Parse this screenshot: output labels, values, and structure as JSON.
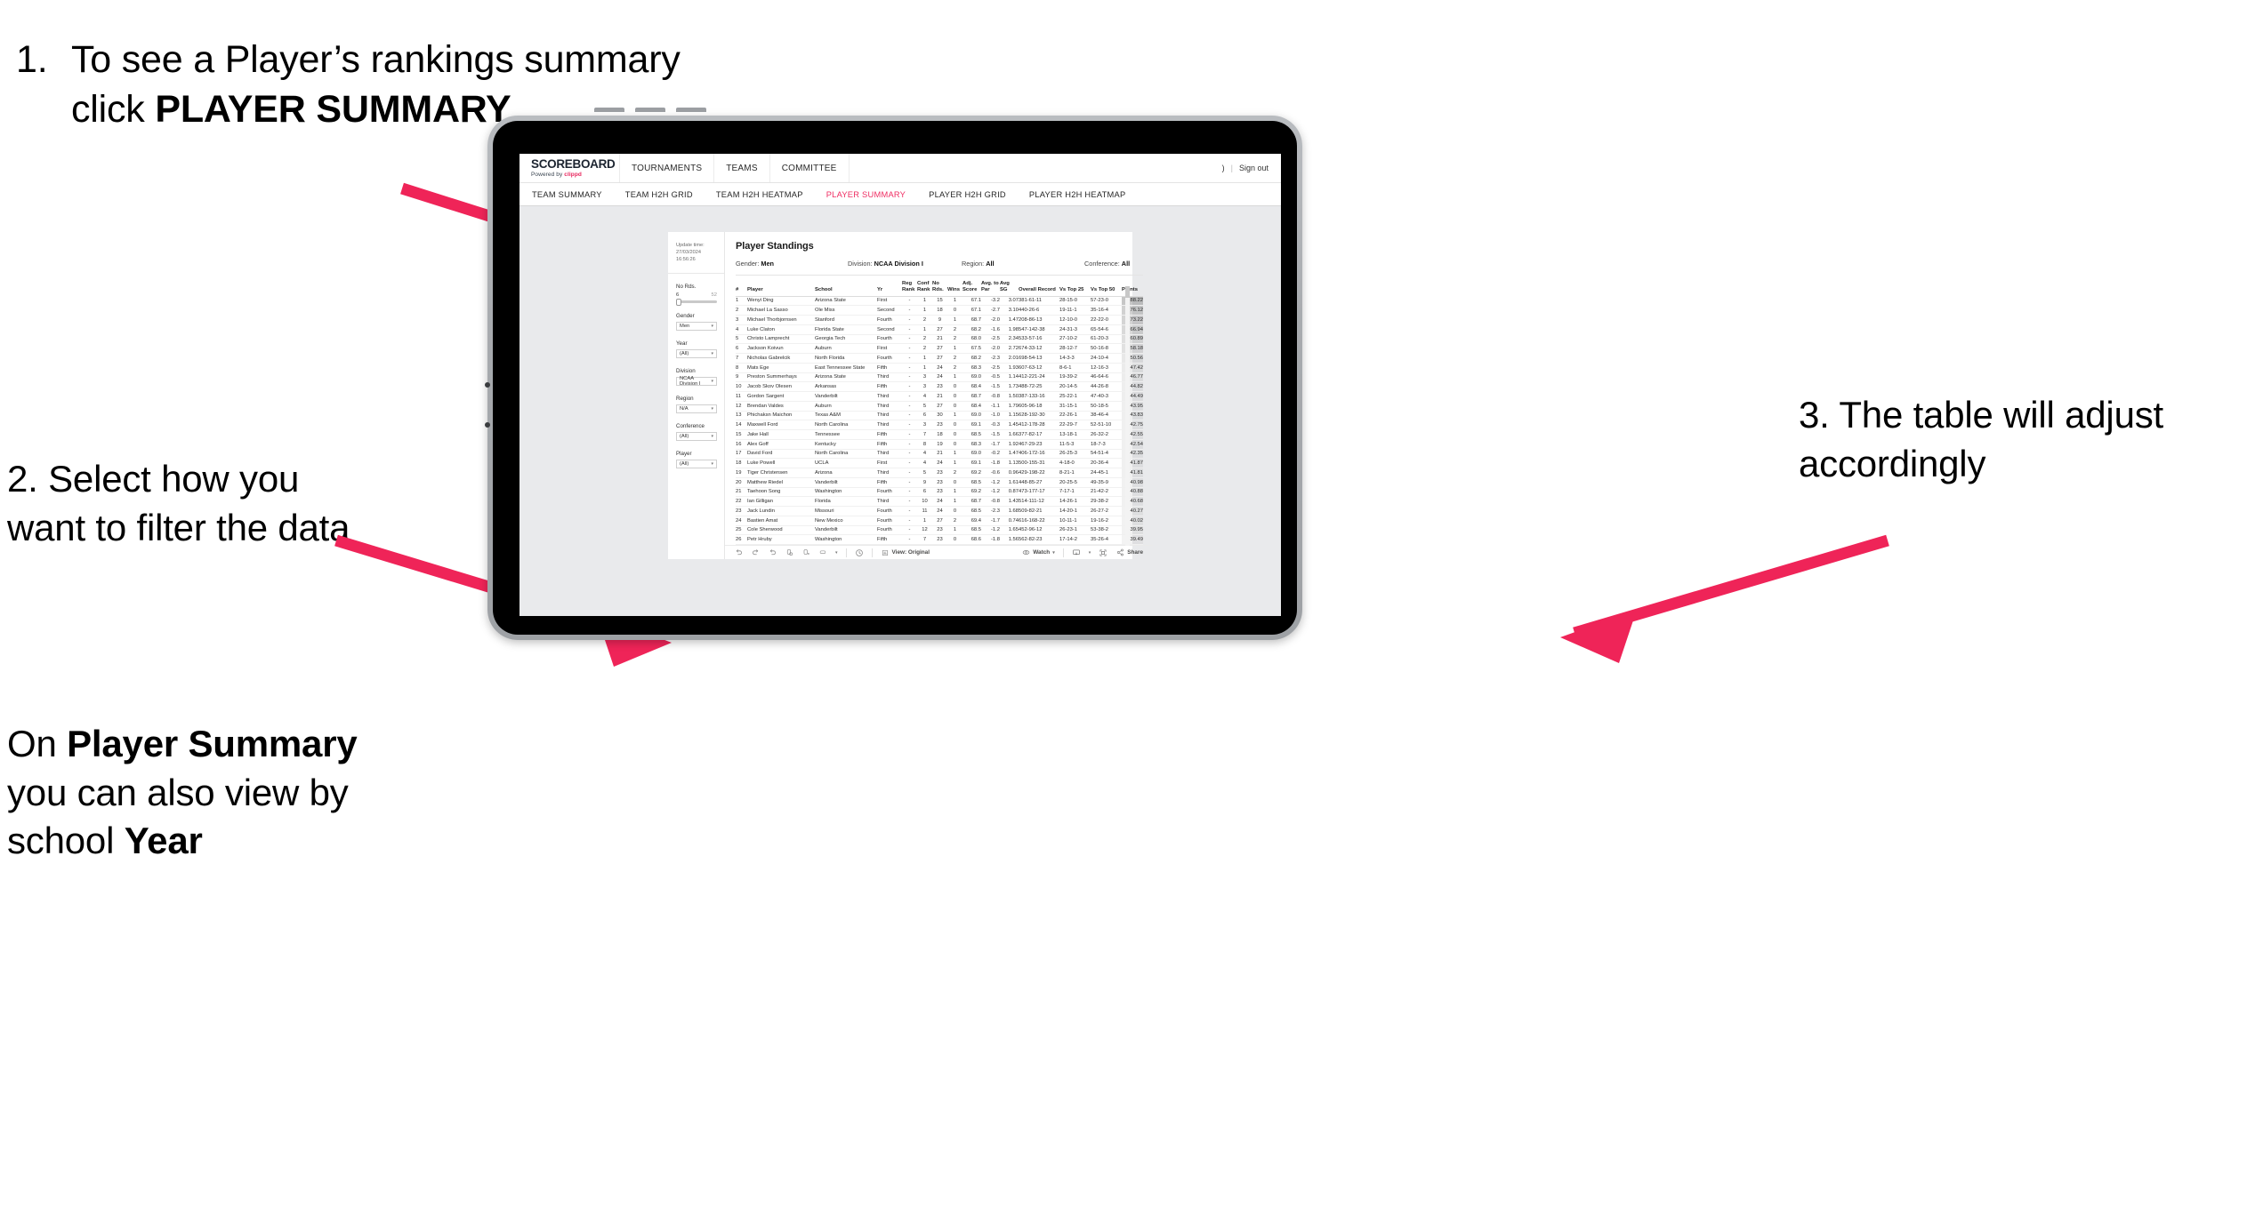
{
  "annotations": {
    "step1": {
      "number": "1.",
      "text_before": "To see a Player’s rankings summary click ",
      "bold": "PLAYER SUMMARY"
    },
    "step2": {
      "text": "2. Select how you want to filter the data"
    },
    "step2b": {
      "line1_before": "On ",
      "line1_bold": "Player Summary",
      "line1_after": " you can also view by school ",
      "line1_bold2": "Year"
    },
    "step3": {
      "text": "3. The table will adjust accordingly"
    },
    "arrow_color": "#ef2458"
  },
  "app": {
    "brand_name": "SCOREBOARD",
    "brand_sub_prefix": "Powered by ",
    "brand_sub_link": "clippd",
    "top_nav": [
      "TOURNAMENTS",
      "TEAMS",
      "COMMITTEE"
    ],
    "user_initial": ")",
    "separator": "|",
    "sign_out": "Sign out",
    "sub_nav": [
      {
        "label": "TEAM SUMMARY",
        "active": false
      },
      {
        "label": "TEAM H2H GRID",
        "active": false
      },
      {
        "label": "TEAM H2H HEATMAP",
        "active": false
      },
      {
        "label": "PLAYER SUMMARY",
        "active": true
      },
      {
        "label": "PLAYER H2H GRID",
        "active": false
      },
      {
        "label": "PLAYER H2H HEATMAP",
        "active": false
      }
    ],
    "active_tab_color": "#ef2d62"
  },
  "sidebar": {
    "update_label": "Update time:",
    "update_value": "27/03/2024 16:56:26",
    "slider": {
      "title": "No Rds.",
      "min": "6",
      "max": "52"
    },
    "filters": [
      {
        "title": "Gender",
        "value": "Men"
      },
      {
        "title": "Year",
        "value": "(All)"
      },
      {
        "title": "Division",
        "value": "NCAA Division I"
      },
      {
        "title": "Region",
        "value": "N/A"
      },
      {
        "title": "Conference",
        "value": "(All)"
      },
      {
        "title": "Player",
        "value": "(All)"
      }
    ]
  },
  "sheet": {
    "title": "Player Standings",
    "summary": [
      {
        "label": "Gender:",
        "value": "Men"
      },
      {
        "label": "Division:",
        "value": "NCAA Division I"
      },
      {
        "label": "Region:",
        "value": "All"
      },
      {
        "label": "Conference:",
        "value": "All"
      }
    ],
    "toolbar": {
      "view_label": "View: Original",
      "watch_label": "Watch",
      "share_label": "Share"
    }
  },
  "chart_data": {
    "type": "table",
    "title": "Player Standings",
    "columns": [
      {
        "key": "rank",
        "label": "#"
      },
      {
        "key": "player",
        "label": "Player"
      },
      {
        "key": "school",
        "label": "School"
      },
      {
        "key": "yr",
        "label": "Yr"
      },
      {
        "key": "reg_rank",
        "label": "Reg Rank"
      },
      {
        "key": "conf_rank",
        "label": "Conf Rank"
      },
      {
        "key": "no_rds",
        "label": "No Rds."
      },
      {
        "key": "wins",
        "label": "Wins"
      },
      {
        "key": "adj_score",
        "label": "Adj. Score"
      },
      {
        "key": "avg_to_par",
        "label": "Avg. to Par"
      },
      {
        "key": "avg_sg",
        "label": "Avg SG"
      },
      {
        "key": "overall_record",
        "label": "Overall Record"
      },
      {
        "key": "vs_top_25",
        "label": "Vs Top 25"
      },
      {
        "key": "vs_top_50",
        "label": "Vs Top 50"
      },
      {
        "key": "points",
        "label": "Points"
      }
    ],
    "rows": [
      [
        "1",
        "Wenyi Ding",
        "Arizona State",
        "First",
        "-",
        "1",
        "15",
        "1",
        "67.1",
        "-3.2",
        "3.07",
        "381-61-11",
        "28-15-0",
        "57-23-0",
        "88.22"
      ],
      [
        "2",
        "Michael La Sasso",
        "Ole Miss",
        "Second",
        "-",
        "1",
        "18",
        "0",
        "67.1",
        "-2.7",
        "3.10",
        "440-26-6",
        "19-11-1",
        "35-16-4",
        "76.12"
      ],
      [
        "3",
        "Michael Thorbjornsen",
        "Stanford",
        "Fourth",
        "-",
        "2",
        "9",
        "1",
        "68.7",
        "-2.0",
        "1.47",
        "208-86-13",
        "12-10-0",
        "22-22-0",
        "73.22"
      ],
      [
        "4",
        "Luke Claton",
        "Florida State",
        "Second",
        "-",
        "1",
        "27",
        "2",
        "68.2",
        "-1.6",
        "1.98",
        "547-142-38",
        "24-31-3",
        "65-54-6",
        "66.94"
      ],
      [
        "5",
        "Christo Lamprecht",
        "Georgia Tech",
        "Fourth",
        "-",
        "2",
        "21",
        "2",
        "68.0",
        "-2.5",
        "2.34",
        "533-57-16",
        "27-10-2",
        "61-20-3",
        "60.89"
      ],
      [
        "6",
        "Jackson Koivun",
        "Auburn",
        "First",
        "-",
        "2",
        "27",
        "1",
        "67.5",
        "-2.0",
        "2.72",
        "674-33-12",
        "28-12-7",
        "50-16-8",
        "58.18"
      ],
      [
        "7",
        "Nicholas Gabrelcik",
        "North Florida",
        "Fourth",
        "-",
        "1",
        "27",
        "2",
        "68.2",
        "-2.3",
        "2.01",
        "698-54-13",
        "14-3-3",
        "24-10-4",
        "50.56"
      ],
      [
        "8",
        "Mats Ege",
        "East Tennessee State",
        "Fifth",
        "-",
        "1",
        "24",
        "2",
        "68.3",
        "-2.5",
        "1.93",
        "607-63-12",
        "8-6-1",
        "12-16-3",
        "47.42"
      ],
      [
        "9",
        "Preston Summerhays",
        "Arizona State",
        "Third",
        "-",
        "3",
        "24",
        "1",
        "69.0",
        "-0.5",
        "1.14",
        "412-221-24",
        "19-39-2",
        "46-64-6",
        "46.77"
      ],
      [
        "10",
        "Jacob Skov Olesen",
        "Arkansas",
        "Fifth",
        "-",
        "3",
        "23",
        "0",
        "68.4",
        "-1.5",
        "1.73",
        "488-72-25",
        "20-14-5",
        "44-26-8",
        "44.82"
      ],
      [
        "11",
        "Gordon Sargent",
        "Vanderbilt",
        "Third",
        "-",
        "4",
        "21",
        "0",
        "68.7",
        "-0.8",
        "1.50",
        "387-133-16",
        "25-22-1",
        "47-40-3",
        "44.49"
      ],
      [
        "12",
        "Brendan Valdes",
        "Auburn",
        "Third",
        "-",
        "5",
        "27",
        "0",
        "68.4",
        "-1.1",
        "1.79",
        "605-96-18",
        "31-15-1",
        "50-18-5",
        "43.95"
      ],
      [
        "13",
        "Phichaksn Maichon",
        "Texas A&M",
        "Third",
        "-",
        "6",
        "30",
        "1",
        "69.0",
        "-1.0",
        "1.15",
        "628-192-30",
        "22-26-1",
        "38-46-4",
        "43.83"
      ],
      [
        "14",
        "Maxwell Ford",
        "North Carolina",
        "Third",
        "-",
        "3",
        "23",
        "0",
        "69.1",
        "-0.3",
        "1.45",
        "412-178-28",
        "22-29-7",
        "52-51-10",
        "42.75"
      ],
      [
        "15",
        "Jake Hall",
        "Tennessee",
        "Fifth",
        "-",
        "7",
        "18",
        "0",
        "68.5",
        "-1.5",
        "1.66",
        "377-82-17",
        "13-18-1",
        "26-32-2",
        "42.55"
      ],
      [
        "16",
        "Alex Goff",
        "Kentucky",
        "Fifth",
        "-",
        "8",
        "19",
        "0",
        "68.3",
        "-1.7",
        "1.92",
        "467-29-23",
        "11-5-3",
        "18-7-3",
        "42.54"
      ],
      [
        "17",
        "David Ford",
        "North Carolina",
        "Third",
        "-",
        "4",
        "21",
        "1",
        "69.0",
        "-0.2",
        "1.47",
        "406-172-16",
        "26-25-3",
        "54-51-4",
        "42.35"
      ],
      [
        "18",
        "Luke Powell",
        "UCLA",
        "First",
        "-",
        "4",
        "24",
        "1",
        "69.1",
        "-1.8",
        "1.13",
        "500-155-31",
        "4-18-0",
        "20-36-4",
        "41.87"
      ],
      [
        "19",
        "Tiger Christensen",
        "Arizona",
        "Third",
        "-",
        "5",
        "23",
        "2",
        "69.2",
        "-0.6",
        "0.96",
        "429-198-22",
        "8-21-1",
        "24-45-1",
        "41.81"
      ],
      [
        "20",
        "Matthew Riedel",
        "Vanderbilt",
        "Fifth",
        "-",
        "9",
        "23",
        "0",
        "68.5",
        "-1.2",
        "1.61",
        "448-85-27",
        "20-25-5",
        "49-35-9",
        "40.98"
      ],
      [
        "21",
        "Taehoon Song",
        "Washington",
        "Fourth",
        "-",
        "6",
        "23",
        "1",
        "69.2",
        "-1.2",
        "0.87",
        "473-177-17",
        "7-17-1",
        "21-42-2",
        "40.88"
      ],
      [
        "22",
        "Ian Gilligan",
        "Florida",
        "Third",
        "-",
        "10",
        "24",
        "1",
        "68.7",
        "-0.8",
        "1.43",
        "514-111-12",
        "14-26-1",
        "29-38-2",
        "40.68"
      ],
      [
        "23",
        "Jack Lundin",
        "Missouri",
        "Fourth",
        "-",
        "11",
        "24",
        "0",
        "68.5",
        "-2.3",
        "1.68",
        "509-82-21",
        "14-20-1",
        "26-27-2",
        "40.27"
      ],
      [
        "24",
        "Bastien Amat",
        "New Mexico",
        "Fourth",
        "-",
        "1",
        "27",
        "2",
        "69.4",
        "-1.7",
        "0.74",
        "616-168-22",
        "10-11-1",
        "19-16-2",
        "40.02"
      ],
      [
        "25",
        "Cole Sherwood",
        "Vanderbilt",
        "Fourth",
        "-",
        "12",
        "23",
        "1",
        "68.5",
        "-1.2",
        "1.65",
        "452-96-12",
        "26-23-1",
        "53-38-2",
        "39.95"
      ],
      [
        "26",
        "Petr Hruby",
        "Washington",
        "Fifth",
        "-",
        "7",
        "23",
        "0",
        "68.6",
        "-1.8",
        "1.56",
        "562-82-23",
        "17-14-2",
        "35-26-4",
        "39.49"
      ]
    ],
    "points_highlight_color": "#d9d9d9"
  }
}
